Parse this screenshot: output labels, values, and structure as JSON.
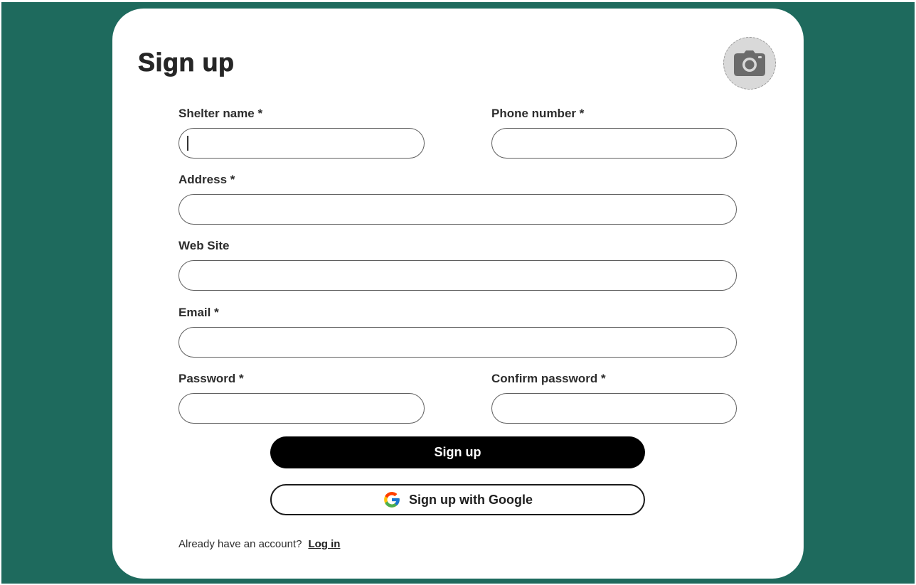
{
  "colors": {
    "background": "#1e6a5d",
    "card": "#ffffff",
    "primary_button": "#000000",
    "field_border": "#5f5f5f"
  },
  "form": {
    "title": "Sign up",
    "photo_icon": "camera-icon",
    "fields": {
      "shelter_name": {
        "label": "Shelter name *",
        "value": ""
      },
      "phone_number": {
        "label": "Phone number *",
        "value": ""
      },
      "address": {
        "label": "Address *",
        "value": ""
      },
      "web_site": {
        "label": "Web Site",
        "value": ""
      },
      "email": {
        "label": "Email *",
        "value": ""
      },
      "password": {
        "label": "Password *",
        "value": ""
      },
      "confirm_password": {
        "label": "Confirm password *",
        "value": ""
      }
    },
    "submit_label": "Sign up",
    "google_label": "Sign up with Google",
    "google_icon": "google-icon",
    "footer_text": "Already have an account?",
    "login_label": "Log in"
  }
}
